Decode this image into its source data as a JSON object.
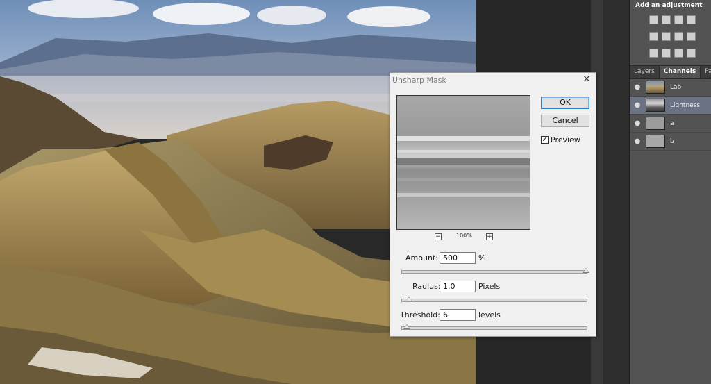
{
  "dialog": {
    "title": "Unsharp Mask",
    "close_icon": "close-icon",
    "ok_label": "OK",
    "cancel_label": "Cancel",
    "preview_label": "Preview",
    "preview_checked": true,
    "zoom_level": "100%",
    "zoom_out_icon": "zoom-out-icon",
    "zoom_in_icon": "zoom-in-icon",
    "amount": {
      "label": "Amount:",
      "value": "500",
      "unit": "%",
      "slider_fraction": 1.0
    },
    "radius": {
      "label": "Radius:",
      "value": "1.0",
      "unit": "Pixels",
      "slider_fraction": 0.04
    },
    "threshold": {
      "label": "Threshold:",
      "value": "6",
      "unit": "levels",
      "slider_fraction": 0.03
    }
  },
  "adjustments": {
    "title": "Add an adjustment",
    "icons_row1": [
      "brightness-contrast-icon",
      "levels-icon",
      "curves-icon",
      "exposure-icon"
    ],
    "icons_row2": [
      "vibrance-icon",
      "color-balance-icon",
      "black-white-icon",
      "photo-filter-icon"
    ],
    "icons_row3": [
      "channel-mixer-icon",
      "gradient-map-icon",
      "selective-color-icon",
      "invert-icon"
    ]
  },
  "panel_tabs": [
    "Layers",
    "Channels",
    "Paths"
  ],
  "active_tab": "Channels",
  "channels": [
    {
      "label": "Lab",
      "selected": false
    },
    {
      "label": "Lightness",
      "selected": true
    },
    {
      "label": "a",
      "selected": false
    },
    {
      "label": "b",
      "selected": false
    }
  ],
  "colors": {
    "dialog_bg": "#f0f0f0",
    "panel_bg": "#535353",
    "selected_row": "#6a7283",
    "primary_button_border": "#2d7fd1"
  }
}
